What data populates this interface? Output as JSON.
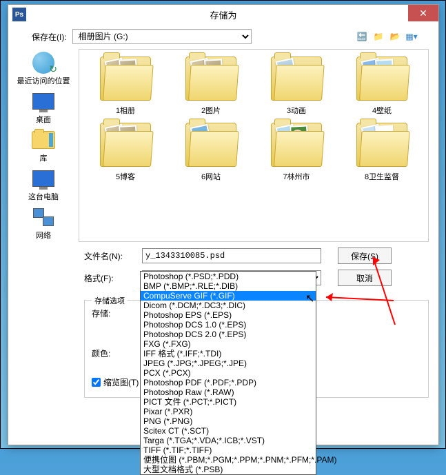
{
  "window": {
    "title": "存储为",
    "close": "✕",
    "ps_icon_text": "Ps"
  },
  "toolbar": {
    "save_in_label": "保存在(I):",
    "location": "相册图片 (G:)",
    "icons": {
      "back": "back-icon",
      "up": "up-icon",
      "new": "new-folder-icon",
      "view": "view-icon"
    }
  },
  "sidebar": [
    {
      "label": "最近访问的位置",
      "icon": "recent"
    },
    {
      "label": "桌面",
      "icon": "desktop"
    },
    {
      "label": "库",
      "icon": "library"
    },
    {
      "label": "这台电脑",
      "icon": "computer"
    },
    {
      "label": "网络",
      "icon": "network"
    }
  ],
  "folders": [
    {
      "name": "1相册",
      "thumbs": [
        "a",
        "b"
      ]
    },
    {
      "name": "2图片",
      "thumbs": [
        "a",
        "b"
      ]
    },
    {
      "name": "3动画",
      "thumbs": [
        "anim"
      ]
    },
    {
      "name": "4壁纸",
      "thumbs": [
        "photo1",
        "photo2"
      ]
    },
    {
      "name": "5博客",
      "thumbs": [
        "a",
        "b"
      ]
    },
    {
      "name": "6网站",
      "thumbs": [
        "web"
      ]
    },
    {
      "name": "7林州市",
      "thumbs": [
        "photo2",
        "photo3"
      ]
    },
    {
      "name": "8卫生监督",
      "thumbs": [
        "photo4",
        "photo5"
      ]
    }
  ],
  "form": {
    "filename_label": "文件名(N):",
    "filename_value": "y_1343310085.psd",
    "format_label": "格式(F):",
    "format_selected": "Photoshop (*.PSD;*.PDD)",
    "save_btn": "保存(S)",
    "cancel_btn": "取消"
  },
  "options_panel": {
    "legend": "存储选项",
    "save_label": "存储:",
    "color_label": "颜色:",
    "thumbnail_label": "缩览图(T)"
  },
  "format_dropdown": [
    "Photoshop (*.PSD;*.PDD)",
    "BMP (*.BMP;*.RLE;*.DIB)",
    "CompuServe GIF (*.GIF)",
    "Dicom (*.DCM;*.DC3;*.DIC)",
    "Photoshop EPS (*.EPS)",
    "Photoshop DCS 1.0 (*.EPS)",
    "Photoshop DCS 2.0 (*.EPS)",
    "FXG (*.FXG)",
    "IFF 格式 (*.IFF;*.TDI)",
    "JPEG (*.JPG;*.JPEG;*.JPE)",
    "PCX (*.PCX)",
    "Photoshop PDF (*.PDF;*.PDP)",
    "Photoshop Raw (*.RAW)",
    "PICT 文件 (*.PCT;*.PICT)",
    "Pixar (*.PXR)",
    "PNG (*.PNG)",
    "Scitex CT (*.SCT)",
    "Targa (*.TGA;*.VDA;*.ICB;*.VST)",
    "TIFF (*.TIF;*.TIFF)",
    "便携位图 (*.PBM;*.PGM;*.PPM;*.PNM;*.PFM;*.PAM)",
    "大型文档格式 (*.PSB)"
  ],
  "selected_format_index": 2
}
